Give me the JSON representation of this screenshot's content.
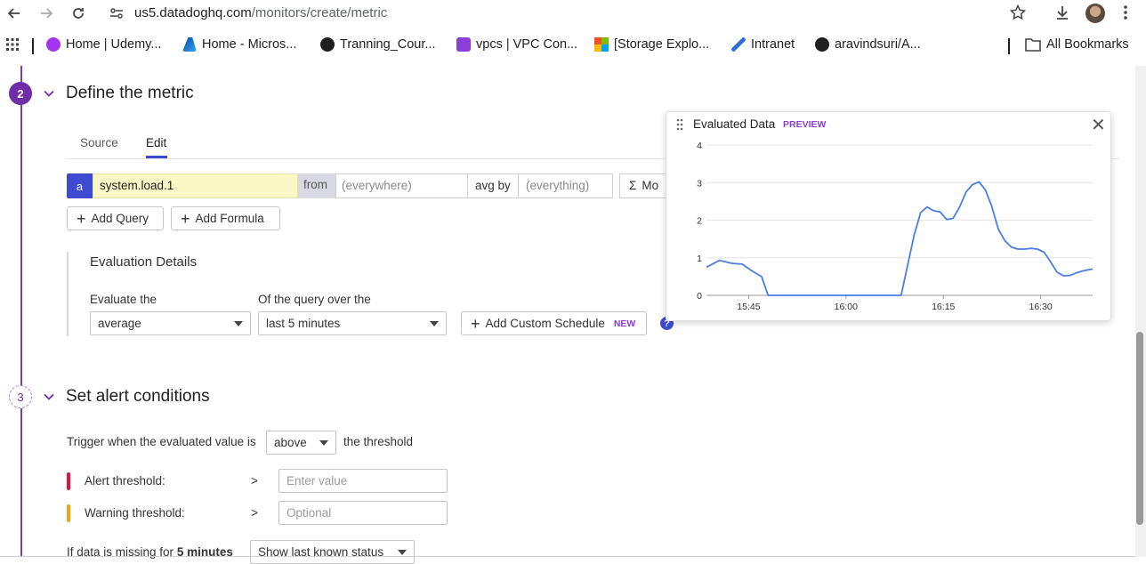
{
  "browser": {
    "url_host": "us5.datadoghq.com",
    "url_path": "/monitors/create/metric",
    "bookmarks": [
      {
        "label": "Home | Udemy...",
        "icon": "udemy-icon",
        "color": "#a435f0"
      },
      {
        "label": "Home - Micros...",
        "icon": "azure-icon",
        "color": "#0078d4"
      },
      {
        "label": "Tranning_Cour...",
        "icon": "github-icon",
        "color": "#1f1f1f"
      },
      {
        "label": "vpcs | VPC Con...",
        "icon": "vpc-icon",
        "color": "#8c3fd6"
      },
      {
        "label": "[Storage Explo...",
        "icon": "microsoft-icon",
        "color": "#f25022"
      },
      {
        "label": "Intranet",
        "icon": "intranet-icon",
        "color": "#2a6fd6"
      },
      {
        "label": "aravindsuri/A...",
        "icon": "github-icon",
        "color": "#1f1f1f"
      }
    ],
    "all_bookmarks": "All Bookmarks"
  },
  "step2": {
    "number": "2",
    "title": "Define the metric",
    "tabs": {
      "source": "Source",
      "edit": "Edit"
    },
    "query": {
      "letter": "a",
      "metric": "system.load.1",
      "from_label": "from",
      "from_placeholder": "(everywhere)",
      "avg_by_label": "avg by",
      "avg_by_placeholder": "(everything)",
      "more_label": "Mo"
    },
    "add_query": "Add Query",
    "add_formula": "Add Formula",
    "evaluation": {
      "title": "Evaluation Details",
      "evaluate_label": "Evaluate the",
      "evaluate_value": "average",
      "over_label": "Of the query over the",
      "over_value": "last 5 minutes",
      "custom_schedule": "Add Custom Schedule",
      "new_badge": "NEW",
      "help": "?"
    }
  },
  "preview": {
    "title": "Evaluated Data",
    "badge": "PREVIEW",
    "close": "✕"
  },
  "chart_data": {
    "type": "line",
    "title": "Evaluated Data",
    "xlabel": "",
    "ylabel": "",
    "ylim": [
      0,
      4
    ],
    "yticks": [
      "0",
      "1",
      "2",
      "3",
      "4"
    ],
    "xticks": [
      {
        "label": "15:45",
        "t": 10
      },
      {
        "label": "16:00",
        "t": 25
      },
      {
        "label": "16:15",
        "t": 40
      },
      {
        "label": "16:30",
        "t": 55
      }
    ],
    "xrange": [
      3.5,
      63
    ],
    "line_color": "#4a7fe0",
    "grid": true,
    "series": [
      {
        "points": [
          [
            3.5,
            0.75
          ],
          [
            5.5,
            0.93
          ],
          [
            7.5,
            0.85
          ],
          [
            9,
            0.83
          ],
          [
            10.5,
            0.65
          ],
          [
            12,
            0.5
          ],
          [
            13,
            0.0
          ],
          [
            22,
            0.0
          ],
          [
            32,
            0.0
          ],
          [
            33.5,
            0.0
          ],
          [
            34.5,
            0.8
          ],
          [
            35.5,
            1.6
          ],
          [
            36.5,
            2.2
          ],
          [
            37.5,
            2.35
          ],
          [
            38.5,
            2.25
          ],
          [
            39.5,
            2.22
          ],
          [
            40.5,
            2.02
          ],
          [
            41.5,
            2.05
          ],
          [
            42.5,
            2.35
          ],
          [
            43.5,
            2.75
          ],
          [
            44.5,
            2.95
          ],
          [
            45.5,
            3.02
          ],
          [
            46.5,
            2.8
          ],
          [
            47.5,
            2.35
          ],
          [
            48.5,
            1.75
          ],
          [
            49.5,
            1.45
          ],
          [
            50.5,
            1.28
          ],
          [
            51.5,
            1.23
          ],
          [
            52.5,
            1.23
          ],
          [
            53.5,
            1.25
          ],
          [
            54.5,
            1.23
          ],
          [
            55.5,
            1.15
          ],
          [
            56.5,
            0.9
          ],
          [
            57.5,
            0.62
          ],
          [
            58.5,
            0.52
          ],
          [
            59.5,
            0.53
          ],
          [
            60.5,
            0.6
          ],
          [
            61.5,
            0.65
          ],
          [
            63,
            0.7
          ]
        ]
      }
    ]
  },
  "step3": {
    "number": "3",
    "title": "Set alert conditions",
    "trigger_prefix": "Trigger when the evaluated value is",
    "trigger_value": "above",
    "trigger_suffix": "the threshold",
    "alert_label": "Alert threshold:",
    "alert_op": ">",
    "alert_placeholder": "Enter value",
    "alert_color": "#e0143c",
    "warning_label": "Warning threshold:",
    "warning_op": ">",
    "warning_placeholder": "Optional",
    "warning_color": "#f2a20c",
    "missing_prefix": "If data is missing for",
    "missing_bold": "5 minutes",
    "missing_value": "Show last known status"
  }
}
